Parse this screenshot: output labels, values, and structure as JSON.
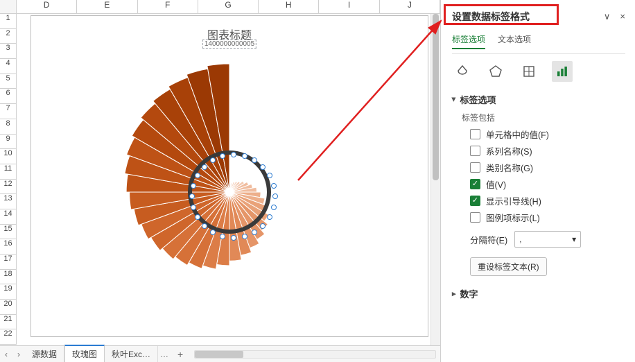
{
  "columns": [
    "D",
    "E",
    "F",
    "G",
    "H",
    "I",
    "J"
  ],
  "rows": [
    "1",
    "2",
    "3",
    "4",
    "5",
    "6",
    "7",
    "8",
    "9",
    "10",
    "11",
    "12",
    "13",
    "14",
    "15",
    "16",
    "17",
    "18",
    "19",
    "20",
    "21",
    "22"
  ],
  "chart": {
    "title": "图表标题",
    "subtitle": "1400000000005"
  },
  "tabs": {
    "prev": "‹",
    "next": "›",
    "items": [
      "源数据",
      "玫瑰图",
      "秋叶Exc…"
    ],
    "active_index": 1,
    "more": "…",
    "add": "+"
  },
  "pane": {
    "title": "设置数据标签格式",
    "collapse": "∨",
    "close": "×",
    "subtabs": {
      "a": "标签选项",
      "b": "文本选项"
    },
    "icons": {
      "fill": "fill-icon",
      "effects": "pentagon-icon",
      "size": "sizeprops-icon",
      "chart": "chartopts-icon"
    },
    "section1": {
      "header": "标签选项",
      "includes_label": "标签包括",
      "checks": [
        {
          "label": "单元格中的值(F)",
          "checked": false
        },
        {
          "label": "系列名称(S)",
          "checked": false
        },
        {
          "label": "类别名称(G)",
          "checked": false
        },
        {
          "label": "值(V)",
          "checked": true
        },
        {
          "label": "显示引导线(H)",
          "checked": true
        },
        {
          "label": "图例项标示(L)",
          "checked": false
        }
      ],
      "separator_label": "分隔符(E)",
      "separator_value": ",",
      "reset_btn": "重设标签文本(R)"
    },
    "section2": {
      "header": "数字"
    }
  },
  "chart_data": {
    "type": "bar",
    "note": "Polar/rose bar chart (Nightingale). 36 wedges, values increase clockwise from top, color ramps light→dark orange/brown.",
    "categories_count": 36,
    "values": [
      10,
      12,
      14,
      16,
      18,
      22,
      26,
      30,
      35,
      40,
      46,
      52,
      58,
      64,
      70,
      76,
      82,
      88,
      94,
      100,
      104,
      108,
      112,
      116,
      120,
      124,
      128,
      132,
      136,
      140,
      144,
      148,
      152,
      156,
      160,
      164
    ],
    "color_ramp": [
      "#f9e3d8",
      "#f6d6c4",
      "#f3c9b1",
      "#f0bc9e",
      "#edaf8b",
      "#e9a279",
      "#e59568",
      "#e18957",
      "#dc7d47",
      "#d67138",
      "#cf662b",
      "#c75c20",
      "#be5216",
      "#b4490e",
      "#a84108",
      "#9b3904"
    ],
    "title": "图表标题",
    "center": "approx (287,255) in chart-canvas coords"
  }
}
